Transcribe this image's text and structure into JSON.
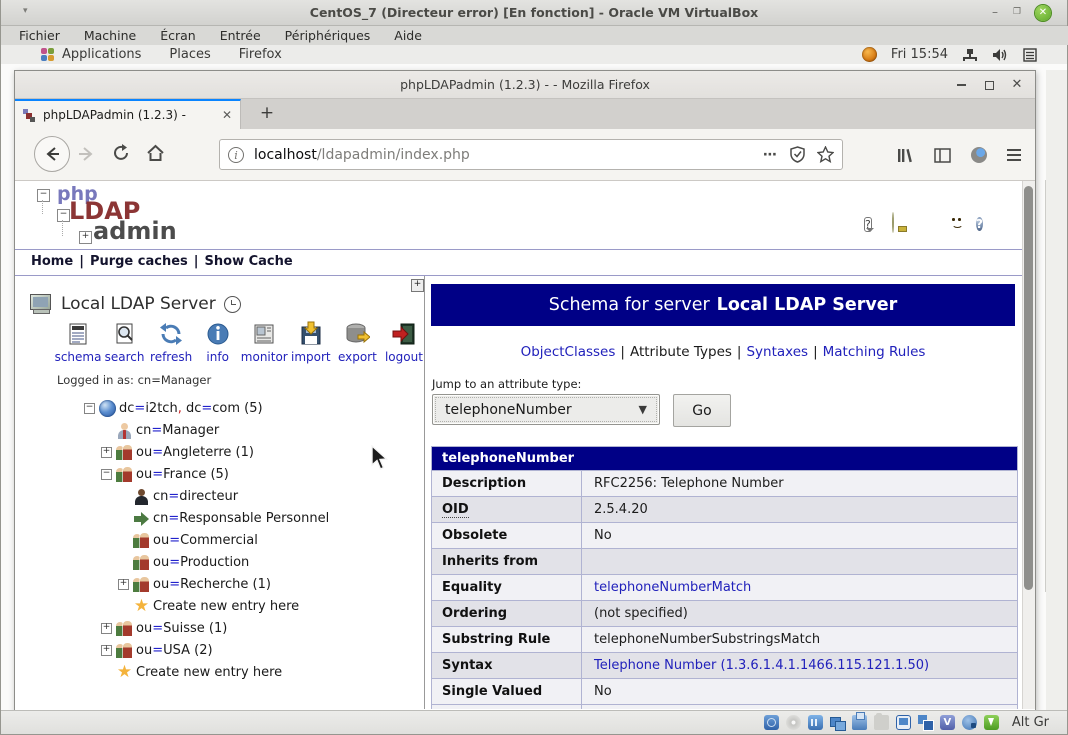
{
  "vbox": {
    "title": "CentOS_7 (Directeur error) [En fonction] - Oracle VM VirtualBox",
    "menu": [
      "Fichier",
      "Machine",
      "Écran",
      "Entrée",
      "Périphériques",
      "Aide"
    ],
    "controls": {
      "minimize": "–",
      "restore": "",
      "close": "✕"
    },
    "statusbar": {
      "icons": [
        "harddisk-icon",
        "optical-disc-icon",
        "audio-icon",
        "network-icon",
        "usb-icon",
        "shared-folders-icon",
        "display-icon",
        "seamless-icon",
        "features-icon",
        "mouse-integration-icon",
        "keyboard-capture-icon"
      ],
      "altgr_label": "Alt Gr"
    }
  },
  "gnome": {
    "menus": [
      "Applications",
      "Places",
      "Firefox"
    ],
    "clock": "Fri 15:54",
    "tray_icons": [
      "updates-icon",
      "network-icon",
      "volume-icon",
      "window-list-icon"
    ]
  },
  "firefox": {
    "window_title": "phpLDAPadmin (1.2.3) - - Mozilla Firefox",
    "tab_title": "phpLDAPadmin (1.2.3) -",
    "tab_close": "✕",
    "new_tab": "+",
    "url_host": "localhost",
    "url_path": "/ldapadmin/index.php",
    "url_dots": "⋯",
    "toolbar_icons": [
      "back-icon",
      "forward-icon",
      "reload-icon",
      "home-icon",
      "info-icon",
      "shield-icon",
      "bookmark-star-icon",
      "library-icon",
      "sidebar-icon",
      "account-icon",
      "menu-icon"
    ]
  },
  "pla": {
    "logo": {
      "php": "php",
      "ldap": "LDAP",
      "admin": "admin"
    },
    "nav_links": [
      "Home",
      "Purge caches",
      "Show Cache"
    ],
    "help_icons": [
      "tooltip-icon",
      "lightbulb-icon",
      "bug-icon",
      "donate-smiley-icon",
      "help-icon"
    ],
    "server_name": "Local LDAP Server",
    "tools": [
      {
        "id": "schema",
        "label": "schema"
      },
      {
        "id": "search",
        "label": "search"
      },
      {
        "id": "refresh",
        "label": "refresh"
      },
      {
        "id": "info",
        "label": "info"
      },
      {
        "id": "monitor",
        "label": "monitor"
      },
      {
        "id": "import",
        "label": "import"
      },
      {
        "id": "export",
        "label": "export"
      },
      {
        "id": "logout",
        "label": "logout"
      }
    ],
    "logged_in": "Logged in as: cn=Manager",
    "tree": [
      {
        "level": 0,
        "expand": "minus",
        "icon": "globe",
        "label": "dc=i2tch, dc=com (5)"
      },
      {
        "level": 1,
        "expand": "",
        "icon": "person",
        "label": "cn=Manager"
      },
      {
        "level": 1,
        "expand": "plus",
        "icon": "people",
        "label": "ou=Angleterre (1)"
      },
      {
        "level": 1,
        "expand": "minus",
        "icon": "people",
        "label": "ou=France (5)"
      },
      {
        "level": 2,
        "expand": "",
        "icon": "person-dark",
        "label": "cn=directeur"
      },
      {
        "level": 2,
        "expand": "",
        "icon": "arrow",
        "label": "cn=Responsable Personnel"
      },
      {
        "level": 2,
        "expand": "",
        "icon": "people",
        "label": "ou=Commercial"
      },
      {
        "level": 2,
        "expand": "",
        "icon": "people",
        "label": "ou=Production"
      },
      {
        "level": 2,
        "expand": "plus",
        "icon": "people",
        "label": "ou=Recherche (1)"
      },
      {
        "level": 2,
        "expand": "",
        "icon": "star",
        "label": "Create new entry here"
      },
      {
        "level": 1,
        "expand": "plus",
        "icon": "people",
        "label": "ou=Suisse (1)"
      },
      {
        "level": 1,
        "expand": "plus",
        "icon": "people",
        "label": "ou=USA (2)"
      },
      {
        "level": 1,
        "expand": "",
        "icon": "star",
        "label": "Create new entry here"
      }
    ]
  },
  "schema": {
    "banner_prefix": "Schema for server",
    "banner_server": "Local LDAP Server",
    "links": [
      {
        "label": "ObjectClasses",
        "link": true
      },
      {
        "label": "Attribute Types",
        "link": false
      },
      {
        "label": "Syntaxes",
        "link": true
      },
      {
        "label": "Matching Rules",
        "link": true
      }
    ],
    "jump_label": "Jump to an attribute type:",
    "jump_value": "telephoneNumber",
    "go_label": "Go",
    "attr_header": "telephoneNumber",
    "rows": [
      {
        "label": "Description",
        "value": "RFC2256: Telephone Number",
        "link": false,
        "tooltip": false,
        "shade": "odd"
      },
      {
        "label": "OID",
        "value": "2.5.4.20",
        "link": false,
        "tooltip": true,
        "shade": "even"
      },
      {
        "label": "Obsolete",
        "value": "No",
        "link": false,
        "tooltip": false,
        "shade": "odd"
      },
      {
        "label": "Inherits from",
        "value": "",
        "link": false,
        "tooltip": false,
        "shade": "even"
      },
      {
        "label": "Equality",
        "value": "telephoneNumberMatch",
        "link": true,
        "tooltip": false,
        "shade": "odd"
      },
      {
        "label": "Ordering",
        "value": "(not specified)",
        "link": false,
        "tooltip": false,
        "shade": "even"
      },
      {
        "label": "Substring Rule",
        "value": "telephoneNumberSubstringsMatch",
        "link": false,
        "tooltip": false,
        "shade": "odd"
      },
      {
        "label": "Syntax",
        "value": "Telephone Number (1.3.6.1.4.1.1466.115.121.1.50)",
        "link": true,
        "tooltip": false,
        "shade": "even"
      },
      {
        "label": "Single Valued",
        "value": "No",
        "link": false,
        "tooltip": false,
        "shade": "odd"
      }
    ]
  }
}
